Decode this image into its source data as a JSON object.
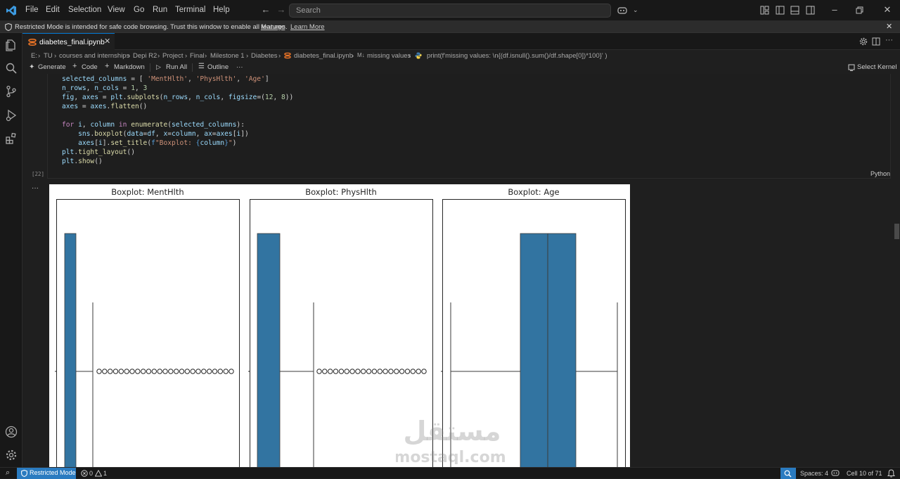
{
  "menu": [
    "File",
    "Edit",
    "Selection",
    "View",
    "Go",
    "Run",
    "Terminal",
    "Help"
  ],
  "search": {
    "placeholder": "Search"
  },
  "banner": {
    "text": "Restricted Mode is intended for safe code browsing. Trust this window to enable all features.",
    "manage": "Manage",
    "learn_more": "Learn More"
  },
  "tab": {
    "name": "diabetes_final.ipynb"
  },
  "breadcrumb": [
    "E:",
    "TU",
    "courses and internships",
    "Depi R2",
    "Project",
    "Final",
    "Milestone 1",
    "Diabetes",
    "diabetes_final.ipynb",
    "missing values",
    "print(f'missing values: \\n{(df.isnull().sum()/df.shape[0])*100}' )"
  ],
  "toolbar": {
    "generate": "Generate",
    "code": "Code",
    "markdown": "Markdown",
    "run_all": "Run All",
    "outline": "Outline",
    "more": "···",
    "select_kernel": "Select Kernel"
  },
  "cell": {
    "number": "[22]",
    "language": "Python",
    "output_menu": "···"
  },
  "plot": {
    "titles": [
      "Boxplot: MentHlth",
      "Boxplot: PhysHlth",
      "Boxplot: Age"
    ],
    "box_color": "#3274a1"
  },
  "watermark": {
    "arabic": "مستقل",
    "latin": "mostaql.com"
  },
  "status": {
    "restricted": "Restricted Mode",
    "errors": "0",
    "warnings": "1",
    "spaces": "Spaces: 4",
    "cell": "Cell 10 of 71"
  },
  "colors": {
    "accent": "#0078d4",
    "status_badge": "#2a7bc0"
  }
}
